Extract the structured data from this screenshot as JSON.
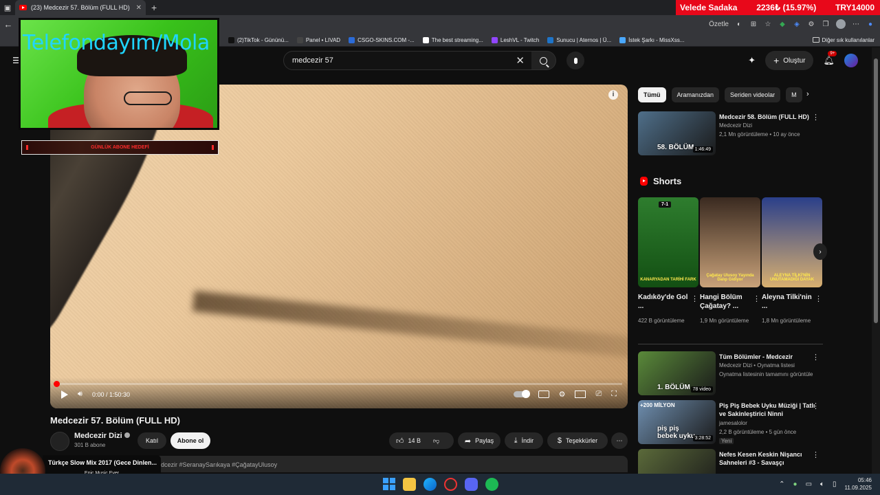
{
  "browser": {
    "tab_title": "(23) Medcezir 57. Bölüm (FULL HD)",
    "bookmarks": [
      {
        "label": "(2)TikTok - Gününü...",
        "color": "#111111"
      },
      {
        "label": "Panel • LIVAD",
        "color": "#444444"
      },
      {
        "label": "CSGO-SKINS.COM -...",
        "color": "#2b6bd8"
      },
      {
        "label": "The best streaming...",
        "color": "#ffffff"
      },
      {
        "label": "LeshVL - Twitch",
        "color": "#9146ff"
      },
      {
        "label": "Sunucu | Aternos | Ü...",
        "color": "#1e74c8"
      },
      {
        "label": "İstek Şarkı - MissXss...",
        "color": "#4aa8ff"
      }
    ],
    "other_bookmarks": "Diğer sık kullanılanlar",
    "summarize": "Özetle"
  },
  "ticker": {
    "label": "Velede Sadaka",
    "amount": "2236₺ (15.97%)",
    "goal": "TRY14000"
  },
  "overlay": {
    "cam_text": "Telefondayım/Mola",
    "sub_goal": "GÜNLÜK ABONE HEDEFİ",
    "music_title": "Türkçe Slow Mix 2017 (Gece Dinlen...",
    "music_artist": "Epic Music Ever"
  },
  "header": {
    "search_value": "medcezir 57",
    "create_label": "Oluştur",
    "bell_badge": "9+"
  },
  "player": {
    "time": "0:00 / 1:50:30",
    "progress": 0.0
  },
  "video": {
    "title": "Medcezir 57. Bölüm (FULL HD)",
    "channel": "Medcezir Dizi",
    "subs": "301 B abone",
    "join": "Katıl",
    "subscribe": "Abone ol",
    "likes": "14 B",
    "share": "Paylaş",
    "download": "İndir",
    "thanks": "Teşekkürler",
    "hashtags": "#SeranaySarıkaya #ÇağatayUlusoy",
    "hashtags_prefix": "edcezir"
  },
  "chips": [
    "Tümü",
    "Aramanızdan",
    "Seriden videolar",
    "M"
  ],
  "recs": [
    {
      "title": "Medcezir 58. Bölüm (FULL HD)",
      "meta1": "Medcezir Dizi",
      "meta2": "2,1 Mn görüntüleme • 10 ay önce",
      "badge": "1:46:49",
      "overlay": "58. BÖLÜM",
      "color": "#4f6f8a"
    },
    {
      "title": "Tüm Bölümler - Medcezir",
      "meta1": "Medcezir Dizi • Oynatma listesi",
      "meta2": "Oynatma listesinin tamamını görüntüle",
      "badge": "78 video",
      "overlay": "1. BÖLÜM",
      "color": "#5a8a3a"
    },
    {
      "title": "Piş Piş Bebek Uyku Müziği | Tatlı ve Sakinleştirici Ninni",
      "meta1": "jamesalolor",
      "meta2": "2,2 B görüntüleme • 5 gün önce",
      "meta3": "Yeni",
      "badge": "3:28:52",
      "overlay": "piş piş bebek uyku",
      "overlay_top": "+200 MİLYON",
      "color": "#6f8fb0"
    },
    {
      "title": "Nefes Kesen Keskin Nişancı Sahneleri #3 - Savaşçı",
      "meta1": "",
      "meta2": "",
      "badge": "",
      "overlay": "",
      "color": "#5b6a3a"
    }
  ],
  "shorts": {
    "heading": "Shorts",
    "items": [
      {
        "title": "Kadıköy'de Gol ...",
        "views": "422 B görüntüleme",
        "caption": "KANARYADAN TARİHİ FARK",
        "header": "7-1",
        "color1": "#2e7d2e",
        "color2": "#134f13"
      },
      {
        "title": "Hangi Bölüm Çağatay? ...",
        "views": "1,9 Mn görüntüleme",
        "caption": "Çağatay Ulusoy Yayında Dalıp Gidiyor",
        "header": "",
        "color1": "#3a2a20",
        "color2": "#c9a27a"
      },
      {
        "title": "Aleyna Tilki'nin ...",
        "views": "1,8 Mn görüntüleme",
        "caption": "ALEYNA TİLKİ'NİN UNUTAMADIĞI DAYAK",
        "header": "",
        "color1": "#2a3f8a",
        "color2": "#d9b070"
      }
    ]
  },
  "taskbar": {
    "time": "05:46",
    "date": "11.09.2025"
  }
}
